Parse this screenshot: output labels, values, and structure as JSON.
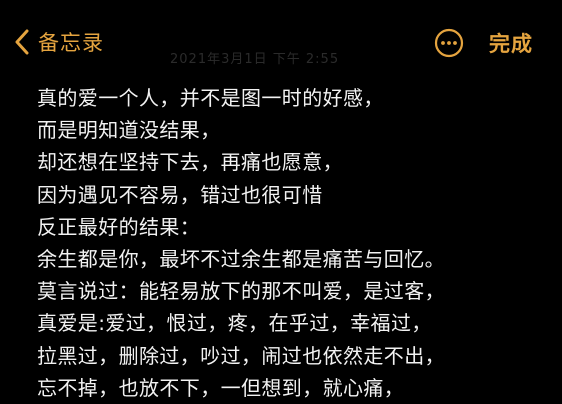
{
  "nav": {
    "back_label": "备忘录",
    "done_label": "完成",
    "back_icon": "chevron-left-icon",
    "more_icon": "ellipsis-circle-icon"
  },
  "meta": {
    "timestamp": "2021年3月1日 下午 2:55"
  },
  "note": {
    "lines": [
      "真的爱一个人，并不是图一时的好感，",
      "而是明知道没结果，",
      "却还想在坚持下去，再痛也愿意，",
      "因为遇见不容易，错过也很可惜",
      "反正最好的结果：",
      "余生都是你，最坏不过余生都是痛苦与回忆。",
      "莫言说过：能轻易放下的那不叫爱，是过客，",
      "真爱是:爱过，恨过，疼，在乎过，幸福过，",
      "拉黑过，删除过，吵过，闹过也依然走不出，",
      "忘不掉，也放不下，一但想到，就心痛，"
    ]
  },
  "colors": {
    "background": "#000000",
    "accent": "#e5a43f",
    "text": "#f2f2f2"
  }
}
